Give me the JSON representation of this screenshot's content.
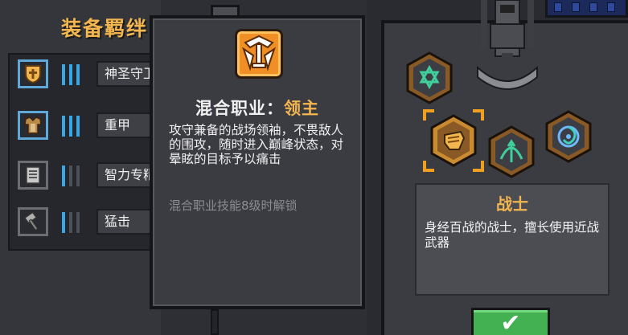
{
  "panel": {
    "title": "装备羁绊",
    "sets": [
      {
        "name": "神圣守卫",
        "icon": "holy-shield-icon",
        "active_bars": 3,
        "total_bars": 3,
        "active": true
      },
      {
        "name": "重甲",
        "icon": "heavy-armor-icon",
        "active_bars": 3,
        "total_bars": 3,
        "active": true
      },
      {
        "name": "智力专精",
        "icon": "scroll-icon",
        "active_bars": 1,
        "total_bars": 3,
        "active": false
      },
      {
        "name": "猛击",
        "icon": "hammer-icon",
        "active_bars": 1,
        "total_bars": 3,
        "active": false
      }
    ]
  },
  "tooltip": {
    "icon": "sword-crest-icon",
    "title_label": "混合职业：",
    "title_name": "领主",
    "description": "攻守兼备的战场领袖，不畏敌人的围攻，随时进入巅峰状态，对晕眩的目标予以痛击",
    "unlock_hint": "混合职业技能8级时解锁"
  },
  "class_selector": {
    "nodes": [
      {
        "name": "star-class",
        "icon": "hexagram-icon",
        "selected": false
      },
      {
        "name": "warrior-class",
        "icon": "fist-icon",
        "selected": true
      },
      {
        "name": "ranger-class",
        "icon": "bow-icon",
        "selected": false
      },
      {
        "name": "mage-class",
        "icon": "vortex-icon",
        "selected": false
      }
    ],
    "selected_name": "战士",
    "selected_description": "身经百战的战士，擅长使用近战武器",
    "confirm_icon": "checkmark-icon"
  },
  "colors": {
    "accent_gold": "#f3b64e",
    "bar_blue": "#37a7ea",
    "confirm_green": "#43b052",
    "emblem_orange": "#f08f25"
  }
}
